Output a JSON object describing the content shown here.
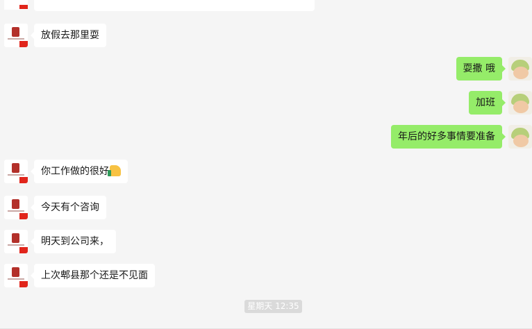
{
  "messages": [
    {
      "side": "left",
      "text": "放假去那里耍"
    },
    {
      "side": "right",
      "text": "耍撒 哦"
    },
    {
      "side": "right",
      "text": "加班"
    },
    {
      "side": "right",
      "text": "年后的好多事情要准备"
    },
    {
      "side": "left",
      "text": "你工作做的很好",
      "emoji": "thumbs-up"
    },
    {
      "side": "left",
      "text": "今天有个咨询"
    },
    {
      "side": "left",
      "text": "明天到公司来，"
    },
    {
      "side": "left",
      "text": "上次郫县那个还是不见面"
    }
  ],
  "timestamp": "星期天 12:35",
  "colors": {
    "background": "#f5f5f5",
    "incoming": "#ffffff",
    "outgoing": "#95ec69"
  }
}
